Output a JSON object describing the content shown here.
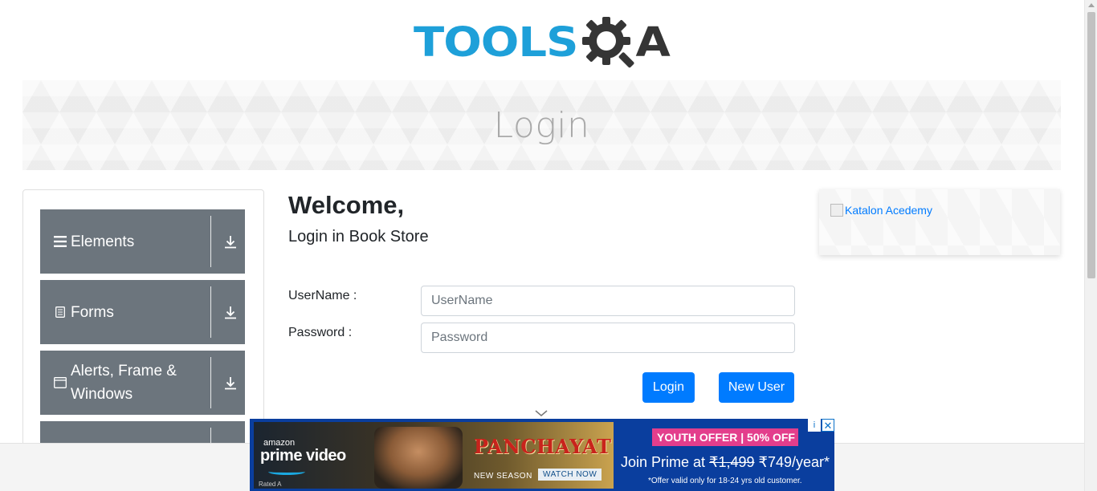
{
  "header": {
    "logo_text_1": "TOOLS",
    "logo_text_2": "A",
    "logo_colors": {
      "tools": "#1ea0d9",
      "gear": "#353535"
    }
  },
  "banner": {
    "title": "Login"
  },
  "left_menu": {
    "groups": [
      {
        "label": "Elements",
        "icon": "hamburger-icon"
      },
      {
        "label": "Forms",
        "icon": "document-icon"
      },
      {
        "label": "Alerts, Frame & Windows",
        "icon": "window-icon"
      },
      {
        "label": "",
        "icon": ""
      }
    ],
    "group_bg": "#6c757d"
  },
  "form": {
    "welcome": "Welcome,",
    "subtitle": "Login in Book Store",
    "username_label": "UserName :",
    "username_placeholder": "UserName",
    "username_value": "",
    "password_label": "Password :",
    "password_placeholder": "Password",
    "password_value": "",
    "login_button": "Login",
    "new_user_button": "New User",
    "accent": "#007bff"
  },
  "right_ad": {
    "alt_text": "Katalon Acedemy"
  },
  "bottom_ad": {
    "brand": "amazon",
    "product": "prime video",
    "rating": "Rated A",
    "show": "PANCHAYAT",
    "season": "NEW SEASON",
    "watch": "WATCH NOW",
    "offer": "YOUTH OFFER | 50% OFF",
    "join_prefix": "Join Prime at ",
    "old_price": "₹1,499",
    "new_price": " ₹749/year*",
    "fine_print": "*Offer valid only for 18-24 yrs old customer.",
    "close": "✕",
    "info": "i"
  }
}
